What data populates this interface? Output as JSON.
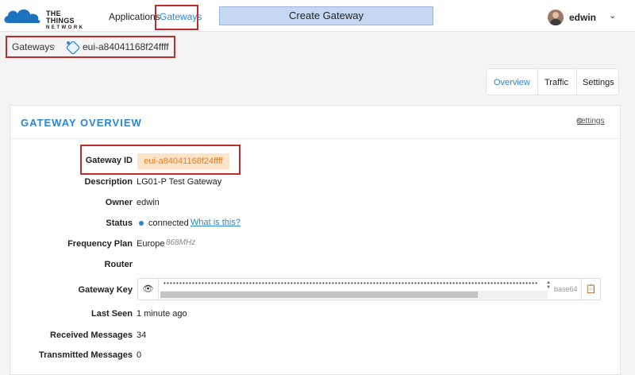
{
  "brand": {
    "line1": "THE THINGS",
    "line2": "NETWORK"
  },
  "nav": {
    "applications": "Applications",
    "gateways": "Gateways"
  },
  "create_gateway": "Create Gateway",
  "user": {
    "name": "edwin"
  },
  "breadcrumb": {
    "root": "Gateways",
    "current": "eui-a84041168f24ffff"
  },
  "tabs": [
    "Overview",
    "Traffic",
    "Settings"
  ],
  "panel": {
    "title": "GATEWAY OVERVIEW",
    "settings_link": "settings"
  },
  "fields": {
    "gateway_id": {
      "label": "Gateway ID",
      "value": "eui-a84041168f24ffff"
    },
    "description": {
      "label": "Description",
      "value": "LG01-P Test Gateway"
    },
    "owner": {
      "label": "Owner",
      "value": "edwin"
    },
    "status": {
      "label": "Status",
      "value": "connected",
      "link": "What is this?"
    },
    "frequency_plan": {
      "label": "Frequency Plan",
      "value": "Europe",
      "sub": "868MHz"
    },
    "router": {
      "label": "Router",
      "value": ""
    },
    "gateway_key": {
      "label": "Gateway Key",
      "encoding": "base64"
    },
    "last_seen": {
      "label": "Last Seen",
      "value": "1 minute ago"
    },
    "received": {
      "label": "Received Messages",
      "value": "34"
    },
    "transmitted": {
      "label": "Transmitted Messages",
      "value": "0"
    }
  },
  "colors": {
    "accent": "#2b86d3",
    "highlight": "#c02a2a",
    "id_chip_bg": "#fde3c7",
    "id_chip_text": "#e67e22"
  }
}
